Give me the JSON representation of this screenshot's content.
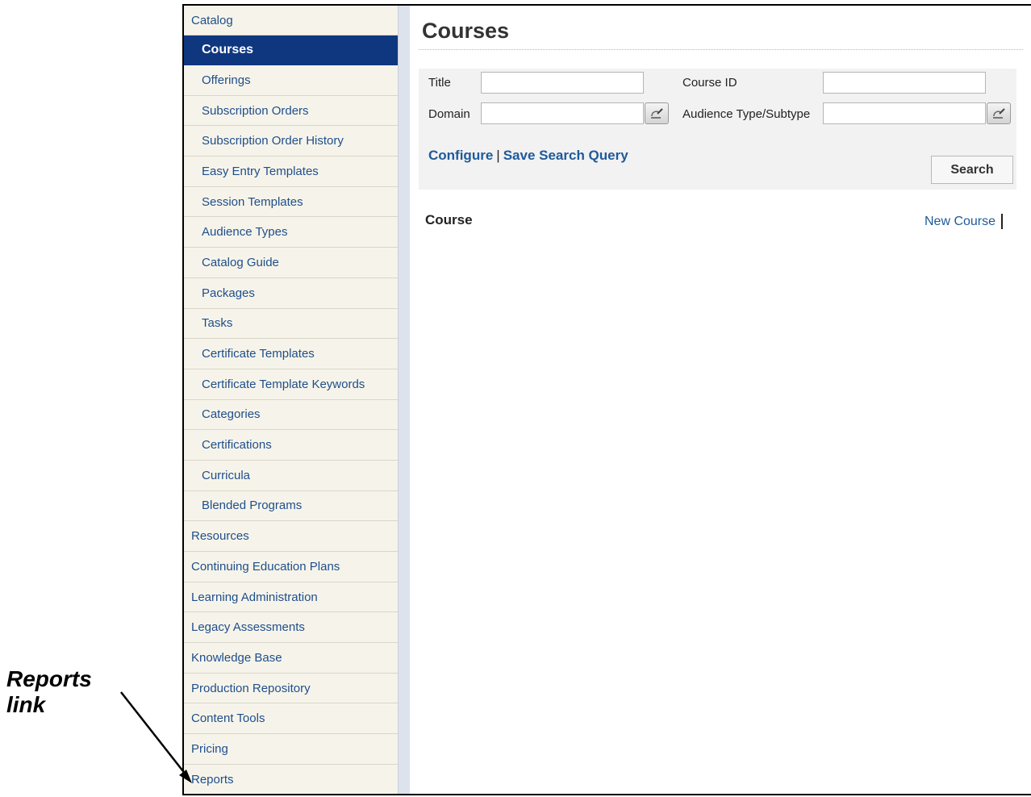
{
  "sidebar": {
    "items": [
      {
        "label": "Catalog",
        "level": "top"
      },
      {
        "label": "Courses",
        "level": "sub",
        "active": true
      },
      {
        "label": "Offerings",
        "level": "sub"
      },
      {
        "label": "Subscription Orders",
        "level": "sub"
      },
      {
        "label": "Subscription Order History",
        "level": "sub"
      },
      {
        "label": "Easy Entry Templates",
        "level": "sub"
      },
      {
        "label": "Session Templates",
        "level": "sub"
      },
      {
        "label": "Audience Types",
        "level": "sub"
      },
      {
        "label": "Catalog Guide",
        "level": "sub"
      },
      {
        "label": "Packages",
        "level": "sub"
      },
      {
        "label": "Tasks",
        "level": "sub"
      },
      {
        "label": "Certificate Templates",
        "level": "sub"
      },
      {
        "label": "Certificate Template Keywords",
        "level": "sub"
      },
      {
        "label": "Categories",
        "level": "sub"
      },
      {
        "label": "Certifications",
        "level": "sub"
      },
      {
        "label": "Curricula",
        "level": "sub"
      },
      {
        "label": "Blended Programs",
        "level": "sub"
      },
      {
        "label": "Resources",
        "level": "top"
      },
      {
        "label": "Continuing Education Plans",
        "level": "top"
      },
      {
        "label": "Learning Administration",
        "level": "top"
      },
      {
        "label": "Legacy Assessments",
        "level": "top"
      },
      {
        "label": "Knowledge Base",
        "level": "top"
      },
      {
        "label": "Production Repository",
        "level": "top"
      },
      {
        "label": "Content Tools",
        "level": "top"
      },
      {
        "label": "Pricing",
        "level": "top"
      },
      {
        "label": "Reports",
        "level": "top"
      }
    ]
  },
  "main": {
    "title": "Courses",
    "search": {
      "title_label": "Title",
      "title_value": "",
      "course_id_label": "Course ID",
      "course_id_value": "",
      "domain_label": "Domain",
      "domain_value": "",
      "audience_label": "Audience Type/Subtype",
      "audience_value": "",
      "configure_link": "Configure",
      "save_query_link": "Save Search Query",
      "search_button": "Search"
    },
    "section_title": "Course",
    "new_course_link": "New Course"
  },
  "annotation": {
    "line1": "Reports",
    "line2": "link"
  },
  "colors": {
    "active_nav_bg": "#0f3780",
    "link": "#1f5a99",
    "sidebar_bg": "#f6f4ea"
  },
  "icons": {
    "picker": "edit-picker-icon",
    "arrow": "arrow-icon"
  }
}
